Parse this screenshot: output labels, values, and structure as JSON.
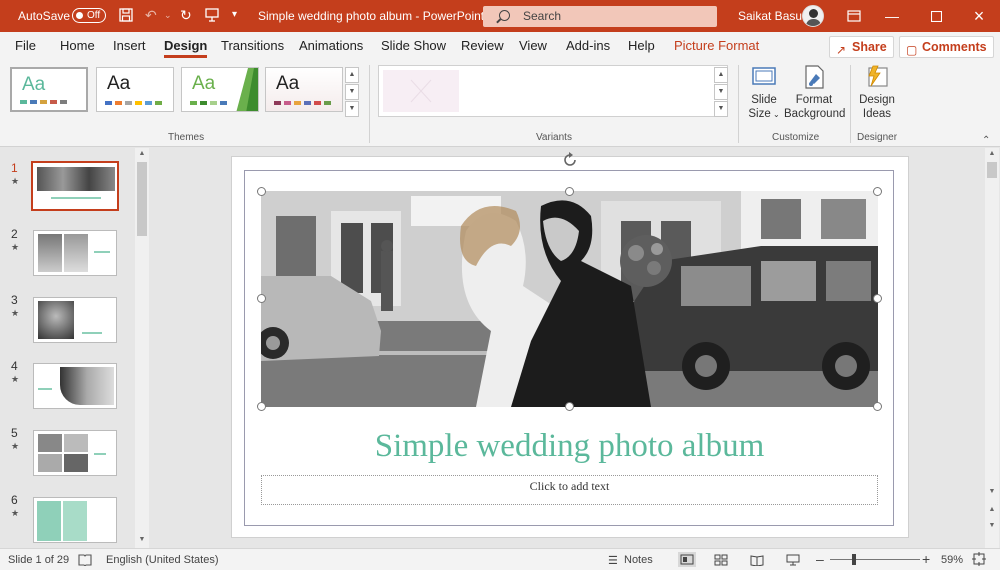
{
  "titlebar": {
    "autosave_label": "AutoSave",
    "autosave_state": "Off",
    "doc_title": "Simple wedding photo album  -  PowerPoint",
    "search_placeholder": "Search",
    "user_name": "Saikat Basu",
    "color": "#c43e1c"
  },
  "tabs": [
    {
      "label": "File"
    },
    {
      "label": "Home"
    },
    {
      "label": "Insert"
    },
    {
      "label": "Design",
      "active": true
    },
    {
      "label": "Transitions"
    },
    {
      "label": "Animations"
    },
    {
      "label": "Slide Show"
    },
    {
      "label": "Review"
    },
    {
      "label": "View"
    },
    {
      "label": "Add-ins"
    },
    {
      "label": "Help"
    },
    {
      "label": "Picture Format",
      "contextual": true
    }
  ],
  "actions": {
    "share": "Share",
    "comments": "Comments"
  },
  "ribbon": {
    "themes_label": "Themes",
    "theme_text": "Aa",
    "variants_label": "Variants",
    "customize_label": "Customize",
    "designer_label": "Designer",
    "slide_size": "Slide Size",
    "slide_size_line1": "Slide",
    "slide_size_line2": "Size",
    "format_background_line1": "Format",
    "format_background_line2": "Background",
    "design_ideas_line1": "Design",
    "design_ideas_line2": "Ideas"
  },
  "thumbnails": [
    {
      "number": "1",
      "selected": true
    },
    {
      "number": "2"
    },
    {
      "number": "3"
    },
    {
      "number": "4"
    },
    {
      "number": "5"
    },
    {
      "number": "6"
    }
  ],
  "slide": {
    "title": "Simple wedding photo album",
    "subtitle_placeholder": "Click to add text",
    "title_color": "#5bb89b"
  },
  "status": {
    "slide_info": "Slide 1 of 29",
    "language": "English (United States)",
    "notes": "Notes",
    "zoom": "59%"
  }
}
